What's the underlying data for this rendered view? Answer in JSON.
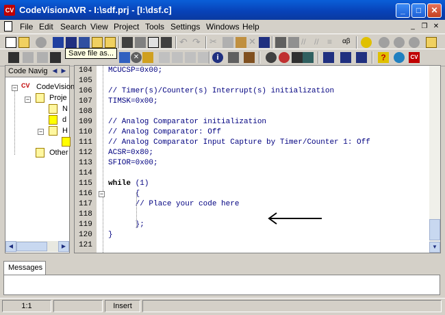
{
  "window": {
    "title": "CodeVisionAVR - I:\\sdf.prj - [I:\\dsf.c]",
    "app_icon": "CV",
    "controls": {
      "minimize": "_",
      "maximize": "□",
      "close": "✕"
    }
  },
  "menu": {
    "items": [
      "File",
      "Edit",
      "Search",
      "View",
      "Project",
      "Tools",
      "Settings",
      "Windows",
      "Help"
    ],
    "mdi_controls": {
      "minimize": "_",
      "restore": "❐",
      "close": "✕"
    }
  },
  "tooltip": {
    "text": "Save file as..."
  },
  "navigator": {
    "title": "Code Navig",
    "tree": [
      {
        "label": "CodeVision"
      },
      {
        "label": "Proje"
      },
      {
        "label": "N"
      },
      {
        "label": "d"
      },
      {
        "label": "H"
      },
      {
        "label": "Other"
      }
    ]
  },
  "editor": {
    "lines": [
      {
        "num": "104",
        "text": "MCUCSP=0x00;"
      },
      {
        "num": "105",
        "text": ""
      },
      {
        "num": "106",
        "text": "// Timer(s)/Counter(s) Interrupt(s) initialization"
      },
      {
        "num": "107",
        "text": "TIMSK=0x00;"
      },
      {
        "num": "108",
        "text": ""
      },
      {
        "num": "109",
        "text": "// Analog Comparator initialization"
      },
      {
        "num": "110",
        "text": "// Analog Comparator: Off"
      },
      {
        "num": "111",
        "text": "// Analog Comparator Input Capture by Timer/Counter 1: Off"
      },
      {
        "num": "112",
        "text": "ACSR=0x80;"
      },
      {
        "num": "113",
        "text": "SFIOR=0x00;"
      },
      {
        "num": "114",
        "text": ""
      },
      {
        "num": "115",
        "keyword": "while",
        "text": " (1)"
      },
      {
        "num": "116",
        "text": "      {"
      },
      {
        "num": "117",
        "text": "      // Place your code here"
      },
      {
        "num": "118",
        "text": ""
      },
      {
        "num": "119",
        "text": "      };"
      },
      {
        "num": "120",
        "text": "}"
      },
      {
        "num": "121",
        "text": ""
      }
    ],
    "fold_marker": "−"
  },
  "messages": {
    "tab_label": "Messages"
  },
  "status": {
    "position": "1:1",
    "mode": "Insert"
  },
  "colors": {
    "comment": "#000080",
    "code": "#000080",
    "keyword": "#000000",
    "title_bar": "#0842b8"
  }
}
